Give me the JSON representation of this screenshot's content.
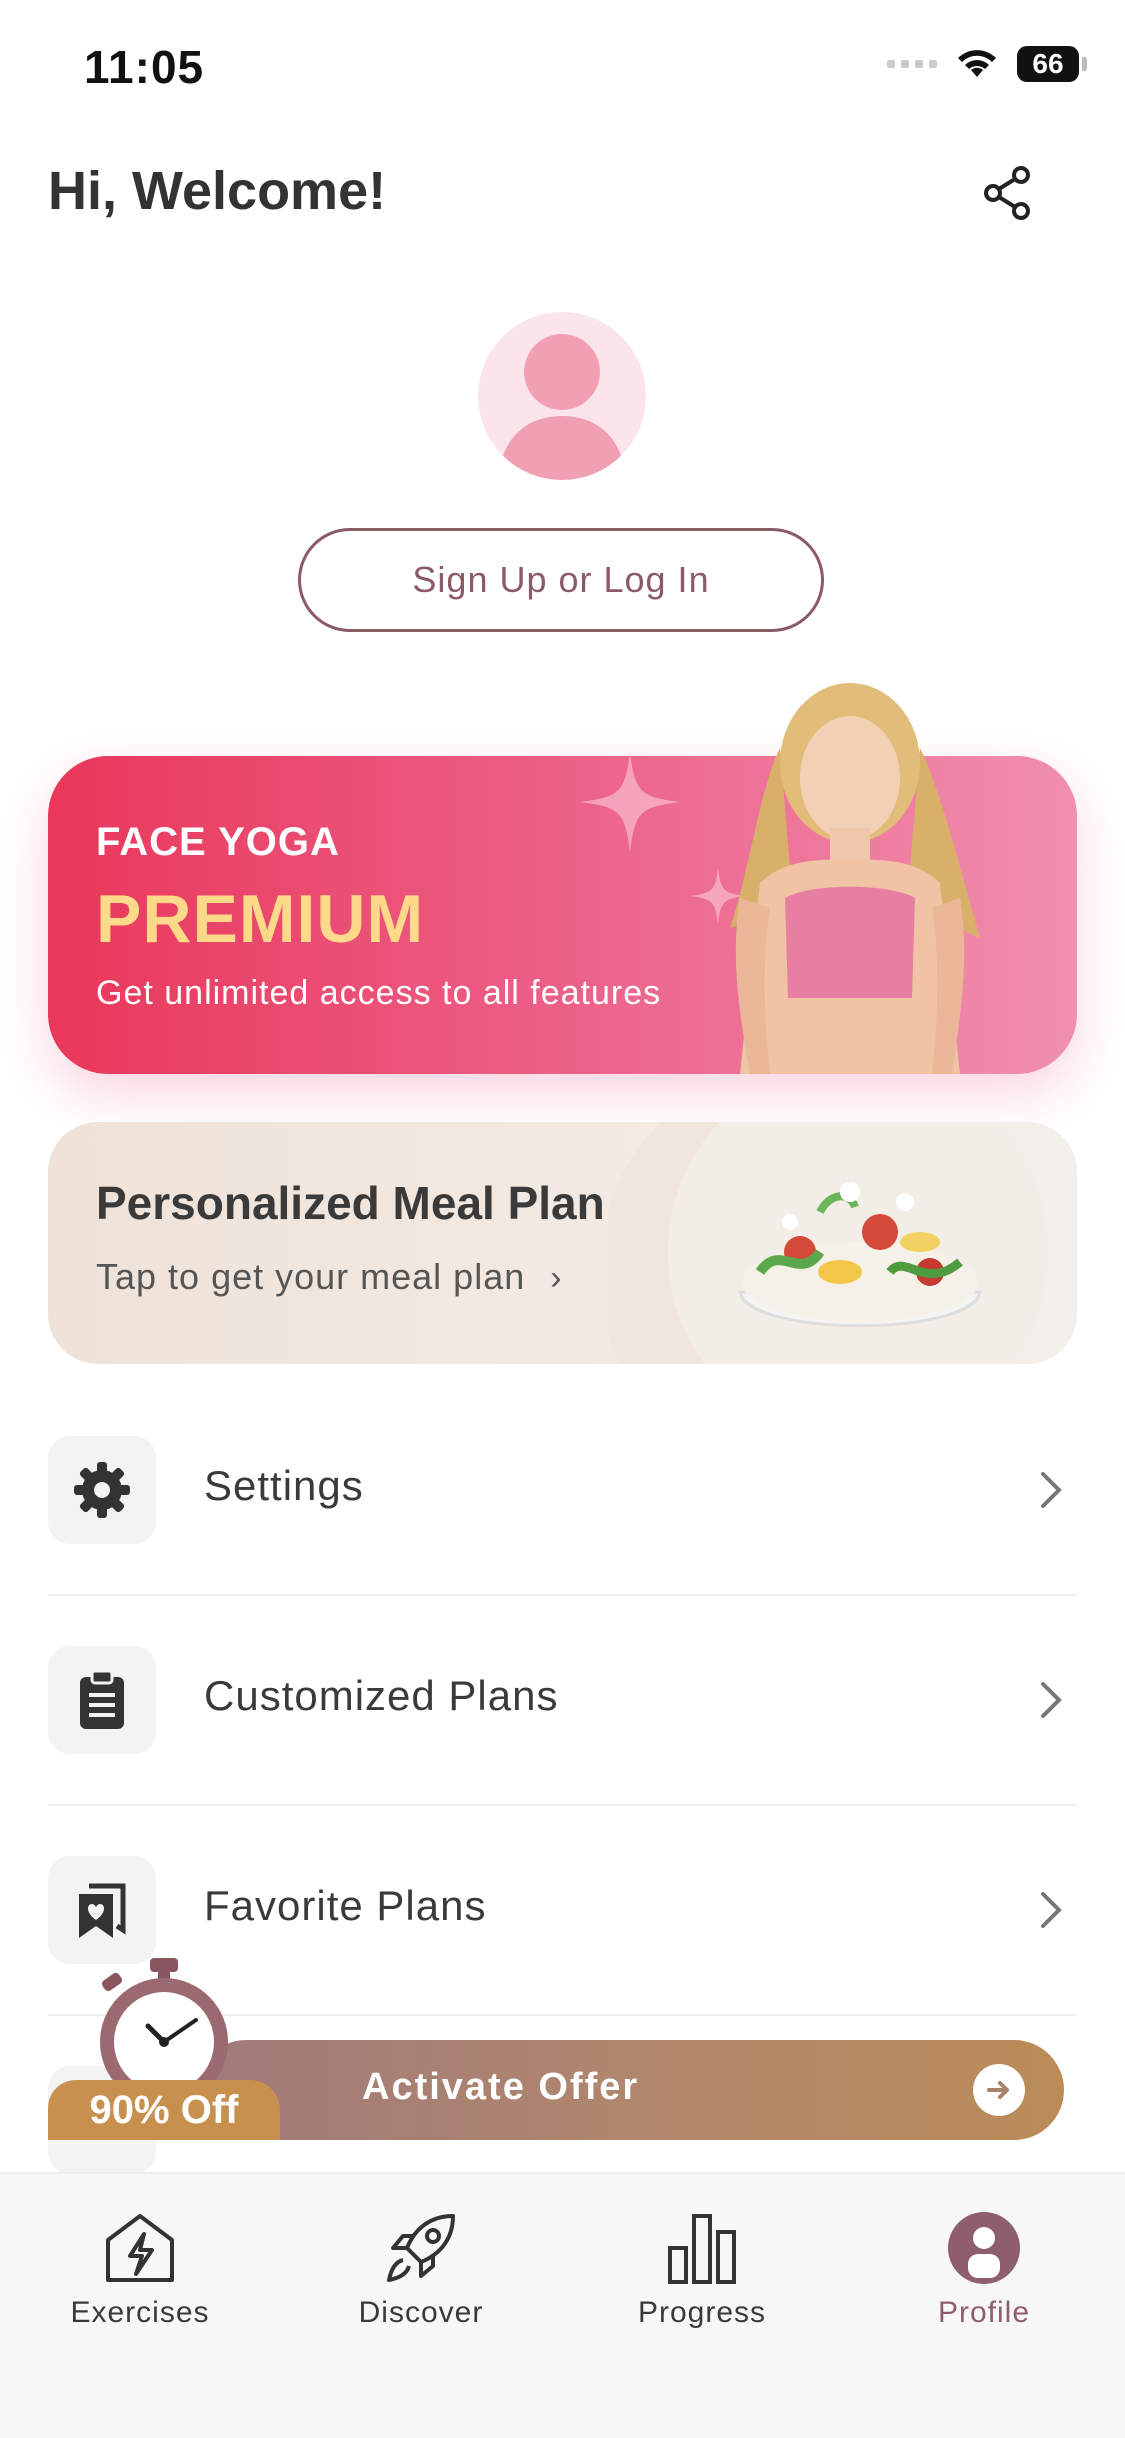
{
  "status_bar": {
    "time": "11:05",
    "battery": "66"
  },
  "header": {
    "greeting": "Hi, Welcome!"
  },
  "profile": {
    "login_label": "Sign Up or Log In"
  },
  "premium_banner": {
    "subtitle": "FACE YOGA",
    "title": "PREMIUM",
    "description": "Get unlimited access to all features"
  },
  "meal_plan": {
    "title": "Personalized Meal Plan",
    "subtitle": "Tap to get your meal plan"
  },
  "menu": {
    "items": [
      {
        "label": "Settings",
        "icon": "gear-icon"
      },
      {
        "label": "Customized Plans",
        "icon": "clipboard-icon"
      },
      {
        "label": "Favorite Plans",
        "icon": "bookmark-heart-icon"
      }
    ]
  },
  "offer": {
    "discount": "90% Off",
    "cta": "Activate Offer"
  },
  "nav": {
    "items": [
      {
        "label": "Exercises",
        "icon": "exercises-icon",
        "active": false
      },
      {
        "label": "Discover",
        "icon": "rocket-icon",
        "active": false
      },
      {
        "label": "Progress",
        "icon": "bar-chart-icon",
        "active": false
      },
      {
        "label": "Profile",
        "icon": "profile-icon",
        "active": true
      }
    ]
  },
  "colors": {
    "accent": "#8f5e6c",
    "premium_start": "#e9375a",
    "premium_end": "#f08fb0",
    "premium_title": "#ffd98a",
    "offer_gold": "#c8904e"
  }
}
